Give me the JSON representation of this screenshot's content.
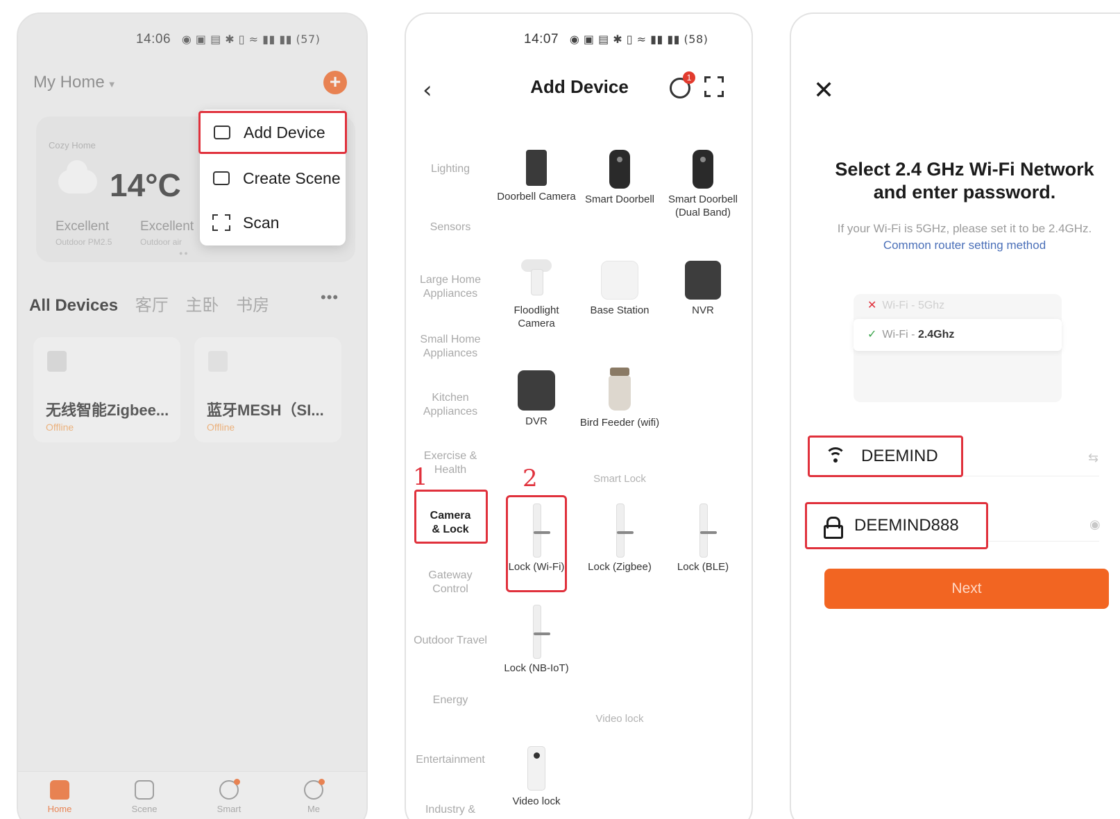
{
  "screen1": {
    "status_time": "14:06",
    "battery": "57",
    "home_title": "My Home",
    "cozy_label": "Cozy Home",
    "temperature": "14°C",
    "air_quality": [
      {
        "value": "Excellent",
        "label": "Outdoor PM2.5"
      },
      {
        "value": "Excellent",
        "label": "Outdoor air"
      }
    ],
    "menu": {
      "items": [
        {
          "label": "Add Device",
          "icon": "add-device-icon"
        },
        {
          "label": "Create Scene",
          "icon": "create-scene-icon"
        },
        {
          "label": "Scan",
          "icon": "scan-icon"
        }
      ]
    },
    "tabs": [
      "All Devices",
      "客厅",
      "主卧",
      "书房"
    ],
    "devices": [
      {
        "name": "无线智能Zigbee...",
        "status": "Offline"
      },
      {
        "name": "蓝牙MESH（SI...",
        "status": "Offline"
      }
    ],
    "tabbar": [
      {
        "label": "Home",
        "icon": "home-icon"
      },
      {
        "label": "Scene",
        "icon": "scene-icon"
      },
      {
        "label": "Smart",
        "icon": "smart-icon"
      },
      {
        "label": "Me",
        "icon": "me-icon"
      }
    ]
  },
  "screen2": {
    "status_time": "14:07",
    "battery": "58",
    "title": "Add Device",
    "radar_badge": "1",
    "categories": [
      "Lighting",
      "Sensors",
      "Large Home Appliances",
      "Small Home Appliances",
      "Kitchen Appliances",
      "Exercise & Health",
      "Camera & Lock",
      "Gateway Control",
      "Outdoor Travel",
      "Energy",
      "Entertainment",
      "Industry &"
    ],
    "selected_category": "Camera & Lock",
    "devices": [
      {
        "name": "Doorbell Camera",
        "icon": "doorbell-camera-icon"
      },
      {
        "name": "Smart Doorbell",
        "icon": "smart-doorbell-icon"
      },
      {
        "name": "Smart Doorbell (Dual Band)",
        "icon": "smart-doorbell-dual-icon"
      },
      {
        "name": "Floodlight Camera",
        "icon": "floodlight-camera-icon"
      },
      {
        "name": "Base Station",
        "icon": "base-station-icon"
      },
      {
        "name": "NVR",
        "icon": "nvr-icon"
      },
      {
        "name": "DVR",
        "icon": "dvr-icon"
      },
      {
        "name": "Bird Feeder (wifi)",
        "icon": "bird-feeder-icon"
      }
    ],
    "smart_lock_header": "Smart Lock",
    "locks": [
      {
        "name": "Lock (Wi-Fi)",
        "icon": "lock-wifi-icon"
      },
      {
        "name": "Lock (Zigbee)",
        "icon": "lock-zigbee-icon"
      },
      {
        "name": "Lock (BLE)",
        "icon": "lock-ble-icon"
      },
      {
        "name": "Lock (NB-IoT)",
        "icon": "lock-nbiot-icon"
      }
    ],
    "video_lock_header": "Video lock",
    "video_locks": [
      {
        "name": "Video lock",
        "icon": "video-lock-icon"
      }
    ],
    "step_labels": [
      "1",
      "2"
    ]
  },
  "screen3": {
    "title": "Select 2.4 GHz Wi-Fi Network and enter password.",
    "subtitle": "If your Wi-Fi is 5GHz, please set it to be 2.4GHz.",
    "link": "Common router setting method",
    "wifi_5g": "Wi-Fi - 5Ghz",
    "wifi_24_prefix": "Wi-Fi - ",
    "wifi_24_band": "2.4Ghz",
    "ssid_value": "DEEMIND",
    "password_value": "DEEMIND888",
    "next_label": "Next"
  },
  "colors": {
    "accent": "#f26522",
    "highlight": "#e0313c",
    "offline": "#f6a55c",
    "link": "#4a6fb8"
  }
}
